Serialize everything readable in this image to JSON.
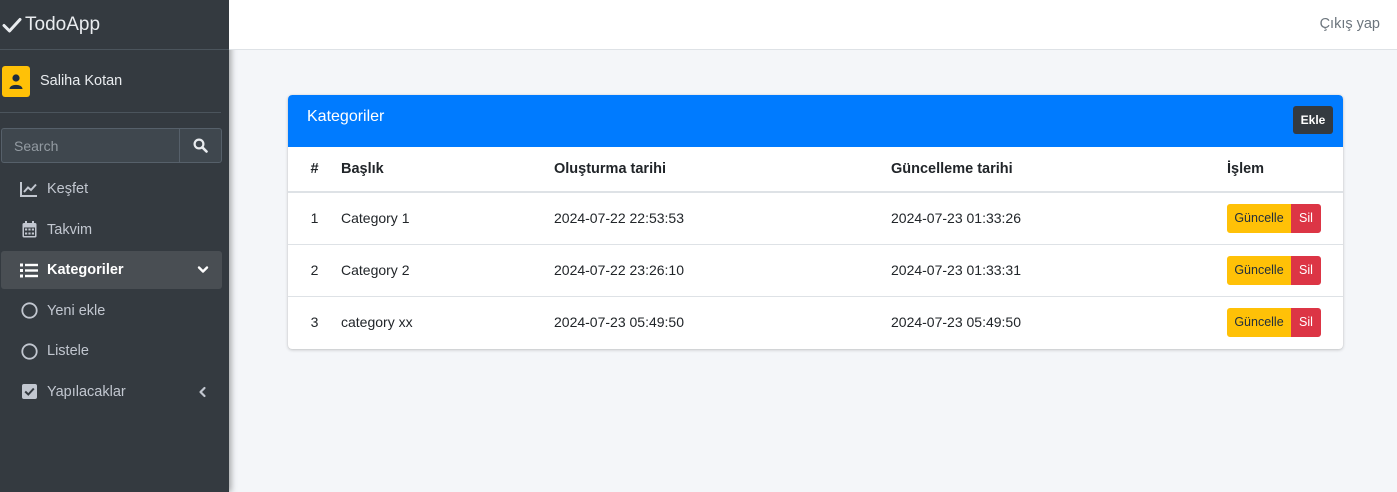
{
  "brand": {
    "name": "TodoApp",
    "icon": "check-icon"
  },
  "user": {
    "name": "Saliha Kotan"
  },
  "search": {
    "placeholder": "Search"
  },
  "nav": [
    {
      "label": "Keşfet",
      "icon": "chart-line-icon"
    },
    {
      "label": "Takvim",
      "icon": "calendar-icon"
    },
    {
      "label": "Kategoriler",
      "icon": "list-icon",
      "active": true
    },
    {
      "label": "Yeni ekle",
      "icon": "circle-icon"
    },
    {
      "label": "Listele",
      "icon": "circle-icon"
    },
    {
      "label": "Yapılacaklar",
      "icon": "check-square-icon"
    }
  ],
  "topbar": {
    "logout": "Çıkış yap"
  },
  "card": {
    "title": "Kategoriler",
    "add_label": "Ekle",
    "columns": [
      "#",
      "Başlık",
      "Oluşturma tarihi",
      "Güncelleme tarihi",
      "İşlem"
    ],
    "rows": [
      {
        "id": "1",
        "title": "Category 1",
        "created": "2024-07-22 22:53:53",
        "updated": "2024-07-23 01:33:26"
      },
      {
        "id": "2",
        "title": "Category 2",
        "created": "2024-07-22 23:26:10",
        "updated": "2024-07-23 01:33:31"
      },
      {
        "id": "3",
        "title": "category xx",
        "created": "2024-07-23 05:49:50",
        "updated": "2024-07-23 05:49:50"
      }
    ],
    "update_label": "Güncelle",
    "delete_label": "Sil"
  },
  "colors": {
    "primary": "#007bff",
    "sidebar": "#343a40",
    "warning": "#ffc107",
    "danger": "#dc3545"
  }
}
